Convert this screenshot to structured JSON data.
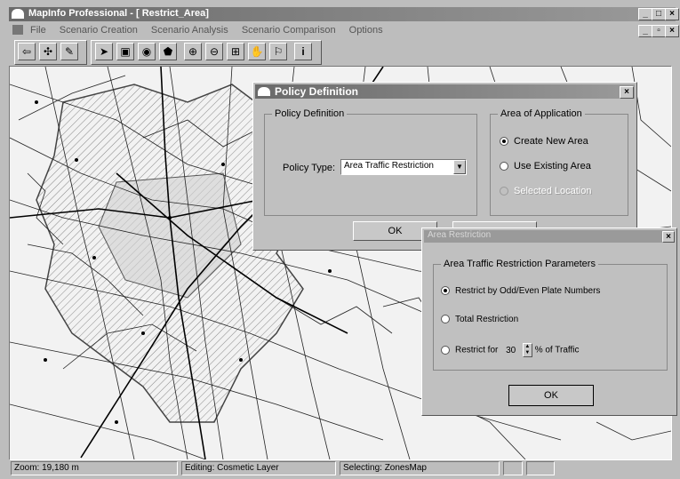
{
  "window": {
    "title": "MapInfo Professional - [ Restrict_Area]",
    "controls": [
      "_",
      "□",
      "×"
    ],
    "doc_controls": [
      "_",
      "▫",
      "×"
    ]
  },
  "menu": [
    "File",
    "Scenario Creation",
    "Scenario Analysis",
    "Scenario Comparison",
    "Options"
  ],
  "policy_dialog": {
    "title": "Policy Definition",
    "left_group": "Policy Definition",
    "policy_type_label": "Policy Type:",
    "policy_type_value": "Area Traffic Restriction",
    "right_group": "Area of Application",
    "options": [
      "Create New Area",
      "Use Existing Area",
      "Selected Location"
    ],
    "ok": "OK"
  },
  "restriction_dialog": {
    "title": "Area Restriction",
    "group": "Area Traffic Restriction Parameters",
    "option_odd_even": "Restrict by Odd/Even Plate Numbers",
    "option_total": "Total Restriction",
    "option_percent_prefix": "Restrict  for",
    "percent_value": "30",
    "option_percent_suffix": "% of Traffic",
    "ok": "OK"
  },
  "status": {
    "zoom": "Zoom: 19,180 m",
    "editing": "Editing: Cosmetic Layer",
    "selecting": "Selecting: ZonesMap"
  }
}
